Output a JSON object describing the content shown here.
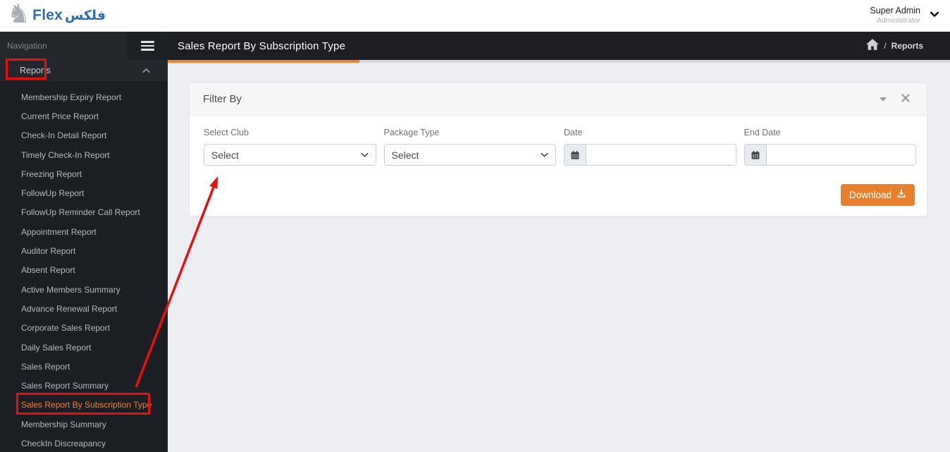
{
  "topbar": {
    "brand": "Flex",
    "brand_ar": "فلكس",
    "user": {
      "name": "Super Admin",
      "role": "Administrator"
    }
  },
  "sidebar": {
    "nav_label": "Navigation",
    "menu_label": "Reports",
    "items": [
      {
        "label": "Membership Expiry Report"
      },
      {
        "label": "Current Price Report"
      },
      {
        "label": "Check-In Detail Report"
      },
      {
        "label": "Timely Check-In Report"
      },
      {
        "label": "Freezing Report"
      },
      {
        "label": "FollowUp Report"
      },
      {
        "label": "FollowUp Reminder Call Report"
      },
      {
        "label": "Appointment Report"
      },
      {
        "label": "Auditor Report"
      },
      {
        "label": "Absent Report"
      },
      {
        "label": "Active Members Summary"
      },
      {
        "label": "Advance Renewal Report"
      },
      {
        "label": "Corporate Sales Report"
      },
      {
        "label": "Daily Sales Report"
      },
      {
        "label": "Sales Report"
      },
      {
        "label": "Sales Report Summary"
      },
      {
        "label": "Sales Report By Subscription Type",
        "active": true
      },
      {
        "label": "Membership Summary"
      },
      {
        "label": "CheckIn Discreapancy"
      }
    ]
  },
  "header": {
    "title": "Sales Report By Subscription Type",
    "breadcrumb": {
      "separator": "/",
      "current": "Reports"
    }
  },
  "filter_panel": {
    "title": "Filter By",
    "fields": [
      {
        "label": "Select Club",
        "type": "select",
        "value": "Select"
      },
      {
        "label": "Package Type",
        "type": "select",
        "value": "Select"
      },
      {
        "label": "Date",
        "type": "date",
        "value": ""
      },
      {
        "label": "End Date",
        "type": "date",
        "value": ""
      }
    ],
    "download_label": "Download"
  },
  "icons": {
    "logo": "horse-logo-icon",
    "user_menu": "chevron-down-icon",
    "sidebar_toggle": "hamburger-menu-icon",
    "menu_state": "chevron-up-icon",
    "breadcrumb_home": "home-icon",
    "panel_collapse": "caret-down-icon",
    "panel_close": "close-icon",
    "select_arrow": "chevron-down-icon",
    "date_prepend": "calendar-icon",
    "download": "download-icon"
  },
  "colors": {
    "accent_orange": "#ef8232",
    "button_orange": "#e8802b",
    "annotation_red": "#e8100f",
    "brand_blue": "#2e6db4",
    "sidebar_dark": "#24272c",
    "submenu_dark": "#1b1e22",
    "titlebar_dark": "#1e1f22",
    "content_bg": "#edeef1"
  }
}
